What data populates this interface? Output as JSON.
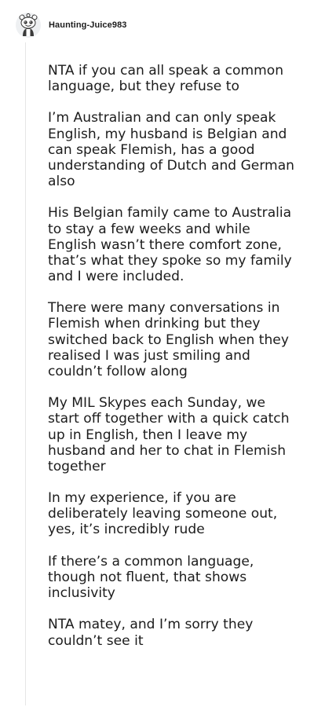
{
  "comment": {
    "username": "Haunting-Juice983",
    "paragraphs": [
      "NTA if you can all speak a common language, but they refuse to",
      "I’m Australian and can only speak English, my husband is Belgian and can speak Flemish, has a good understanding of Dutch and German also",
      "His Belgian family came to Australia to stay a few weeks and while English wasn’t there comfort zone, that’s what they spoke so my family and I were included.",
      "There were many conversations in Flemish when drinking but they switched back to English when they realised I was just smiling and couldn’t follow along",
      "My MIL Skypes each Sunday, we start off together with a quick catch up in English, then I leave my husband and her to chat in Flemish together",
      "In my experience, if you are deliberately leaving someone out, yes, it’s incredibly rude",
      "If there’s a common language, though not fluent, that shows inclusivity",
      "NTA matey, and I’m sorry they couldn’t see it"
    ]
  }
}
